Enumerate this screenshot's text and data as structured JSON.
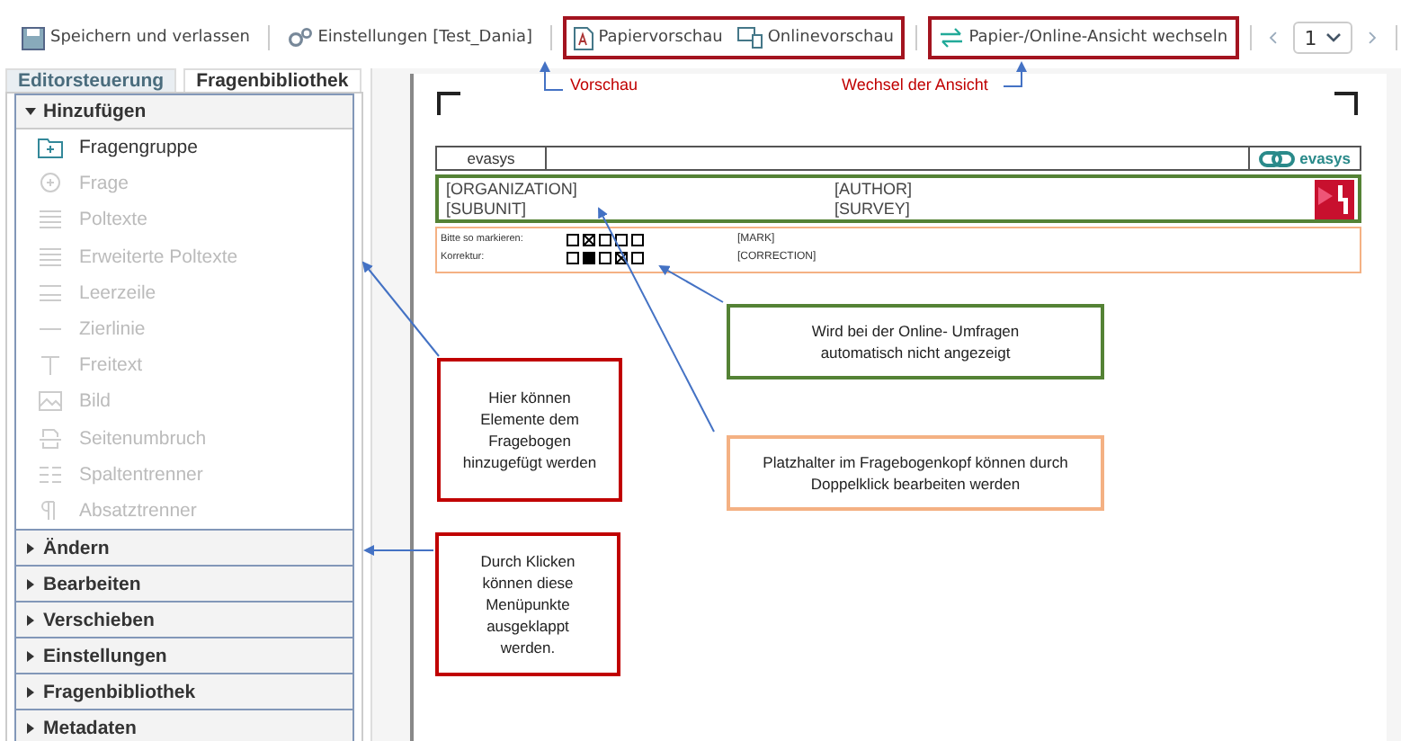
{
  "toolbar": {
    "groups": [
      {
        "framed": false,
        "items": [
          {
            "kind": "save",
            "label": "Speichern und verlassen"
          }
        ]
      },
      {
        "framed": false,
        "items": [
          {
            "kind": "settings",
            "label": "Einstellungen [Test_Dania]"
          }
        ]
      },
      {
        "framed": true,
        "items": [
          {
            "kind": "pdf",
            "label": "Papiervorschau"
          },
          {
            "kind": "online",
            "label": "Onlinevorschau"
          }
        ]
      },
      {
        "framed": true,
        "items": [
          {
            "kind": "switch",
            "label": "Papier-/Online-Ansicht wechseln"
          }
        ]
      }
    ],
    "page_select": "1"
  },
  "tabs": [
    {
      "label": "Editorsteuerung",
      "selected": false
    },
    {
      "label": "Fragenbibliothek",
      "selected": true
    }
  ],
  "sections": [
    {
      "title": "Hinzufügen",
      "expanded": true,
      "items": [
        {
          "kind": "group",
          "label": "Fragengruppe",
          "disabled": false
        },
        {
          "kind": "question",
          "label": "Frage",
          "disabled": true
        },
        {
          "kind": "lines",
          "label": "Poltexte",
          "disabled": true
        },
        {
          "kind": "lines",
          "label": "Erweiterte Poltexte",
          "disabled": true
        },
        {
          "kind": "blank",
          "label": "Leerzeile",
          "disabled": true
        },
        {
          "kind": "rule",
          "label": "Zierlinie",
          "disabled": true
        },
        {
          "kind": "text",
          "label": "Freitext",
          "disabled": true
        },
        {
          "kind": "image",
          "label": "Bild",
          "disabled": true
        },
        {
          "kind": "pagebreak",
          "label": "Seitenumbruch",
          "disabled": true
        },
        {
          "kind": "columns",
          "label": "Spaltentrenner",
          "disabled": true
        },
        {
          "kind": "paragraph",
          "label": "Absatztrenner",
          "disabled": true
        }
      ]
    },
    {
      "title": "Ändern",
      "expanded": false
    },
    {
      "title": "Bearbeiten",
      "expanded": false
    },
    {
      "title": "Verschieben",
      "expanded": false
    },
    {
      "title": "Einstellungen",
      "expanded": false
    },
    {
      "title": "Fragenbibliothek",
      "expanded": false
    },
    {
      "title": "Metadaten",
      "expanded": false
    }
  ],
  "form_page": {
    "header_left": "evasys",
    "logo_text": "evasys",
    "fields": [
      "[ORGANIZATION]",
      "[AUTHOR]",
      "[SUBUNIT]",
      "[SURVEY]"
    ],
    "mark_rows": [
      {
        "label": "Bitte so markieren:",
        "boxes": [
          {
            "crossed": false,
            "filled": false
          },
          {
            "crossed": true,
            "filled": false
          },
          {
            "crossed": false,
            "filled": false
          },
          {
            "crossed": false,
            "filled": false
          },
          {
            "crossed": false,
            "filled": false
          }
        ],
        "placeholder_text": "[MARK]"
      },
      {
        "label": "Korrektur:",
        "boxes": [
          {
            "crossed": false,
            "filled": false
          },
          {
            "crossed": false,
            "filled": true
          },
          {
            "crossed": false,
            "filled": false
          },
          {
            "crossed": true,
            "filled": false
          },
          {
            "crossed": false,
            "filled": false
          }
        ],
        "placeholder_text": "[CORRECTION]"
      }
    ]
  },
  "annotations": {
    "labels": [
      "Vorschau",
      "Wechsel der Ansicht"
    ],
    "callouts": [
      {
        "text": "Hier können Elemente dem Fragebogen hinzugefügt werden",
        "color": "#c00000"
      },
      {
        "text": "Durch Klicken können diese Menüpunkte ausgeklappt werden.",
        "color": "#c00000"
      },
      {
        "text": "Wird bei der Online- Umfragen automatisch nicht angezeigt",
        "color": "#548235"
      },
      {
        "text": "Platzhalter im Fragebogenkopf können durch Doppelklick bearbeiten werden",
        "color": "#f4b183"
      }
    ]
  }
}
